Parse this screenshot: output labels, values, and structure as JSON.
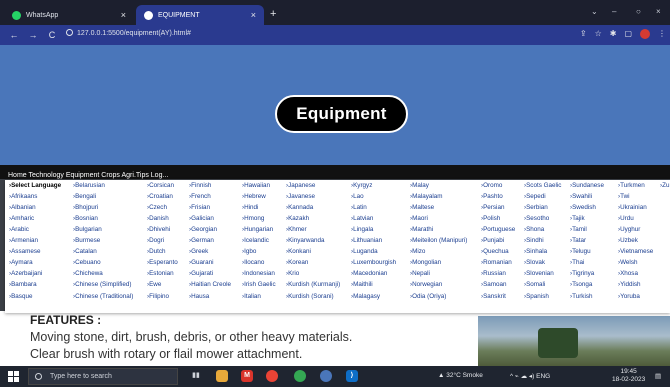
{
  "browser": {
    "tabs": [
      {
        "title": "WhatsApp",
        "close": "×"
      },
      {
        "title": "EQUIPMENT",
        "close": "×"
      }
    ],
    "new_tab": "+",
    "window_controls": [
      "⌄",
      "–",
      "○",
      "×"
    ],
    "nav": {
      "back": "←",
      "forward": "→",
      "reload": "C"
    },
    "url": "127.0.0.1:5500/equipment(AY).html#",
    "right_icons": [
      "⇪",
      "☆",
      "✱",
      "▢",
      "⋮"
    ]
  },
  "page": {
    "title": "Equipment",
    "nav_partial": "Home    Technology    Equipment    Crops    Agri.Tips  Log..."
  },
  "languages": {
    "columns": [
      [
        "Select Language",
        "Afrikaans",
        "Albanian",
        "Amharic",
        "Arabic",
        "Armenian",
        "Assamese",
        "Aymara",
        "Azerbaijani",
        "Bambara",
        "Basque"
      ],
      [
        "Belarusian",
        "Bengali",
        "Bhojpuri",
        "Bosnian",
        "Bulgarian",
        "Burmese",
        "Catalan",
        "Cebuano",
        "Chichewa",
        "Chinese (Simplified)",
        "Chinese (Traditional)"
      ],
      [
        "Corsican",
        "Croatian",
        "Czech",
        "Danish",
        "Dhivehi",
        "Dogri",
        "Dutch",
        "Esperanto",
        "Estonian",
        "Ewe",
        "Filipino"
      ],
      [
        "Finnish",
        "French",
        "Frisian",
        "Galician",
        "Georgian",
        "German",
        "Greek",
        "Guarani",
        "Gujarati",
        "Haitian Creole",
        "Hausa"
      ],
      [
        "Hawaiian",
        "Hebrew",
        "Hindi",
        "Hmong",
        "Hungarian",
        "Icelandic",
        "Igbo",
        "Ilocano",
        "Indonesian",
        "Irish Gaelic",
        "Italian"
      ],
      [
        "Japanese",
        "Javanese",
        "Kannada",
        "Kazakh",
        "Khmer",
        "Kinyarwanda",
        "Konkani",
        "Korean",
        "Krio",
        "Kurdish (Kurmanji)",
        "Kurdish (Sorani)"
      ],
      [
        "Kyrgyz",
        "Lao",
        "Latin",
        "Latvian",
        "Lingala",
        "Lithuanian",
        "Luganda",
        "Luxembourgish",
        "Macedonian",
        "Maithili",
        "Malagasy"
      ],
      [
        "Malay",
        "Malayalam",
        "Maltese",
        "Maori",
        "Marathi",
        "Meiteilon (Manipuri)",
        "Mizo",
        "Mongolian",
        "Nepali",
        "Norwegian",
        "Odia (Oriya)"
      ],
      [
        "Oromo",
        "Pashto",
        "Persian",
        "Polish",
        "Portuguese",
        "Punjabi",
        "Quechua",
        "Romanian",
        "Russian",
        "Samoan",
        "Sanskrit"
      ],
      [
        "Scots Gaelic",
        "Sepedi",
        "Serbian",
        "Sesotho",
        "Shona",
        "Sindhi",
        "Sinhala",
        "Slovak",
        "Slovenian",
        "Somali",
        "Spanish"
      ],
      [
        "Sundanese",
        "Swahili",
        "Swedish",
        "Tajik",
        "Tamil",
        "Tatar",
        "Telugu",
        "Thai",
        "Tigrinya",
        "Tsonga",
        "Turkish"
      ],
      [
        "Turkmen",
        "Twi",
        "Ukrainian",
        "Urdu",
        "Uyghur",
        "Uzbek",
        "Vietnamese",
        "Welsh",
        "Xhosa",
        "Yiddish",
        "Yoruba"
      ],
      [
        "Zu"
      ]
    ]
  },
  "content": {
    "features_heading": "FEATURES :",
    "line1": "Moving stone, dirt, brush, debris, or other heavy materials.",
    "line2": "Clear brush with rotary or flail mower attachment."
  },
  "taskbar": {
    "search_placeholder": "Type here to search",
    "weather": "32°C  Smoke",
    "tray": "^  ⌁  ☁  ◂)  ENG",
    "time": "19:45",
    "date": "18-02-2023"
  },
  "colors": {
    "hero": "#4a76ba",
    "tab_active": "#2a3a8f",
    "link": "#1a3d8f"
  }
}
